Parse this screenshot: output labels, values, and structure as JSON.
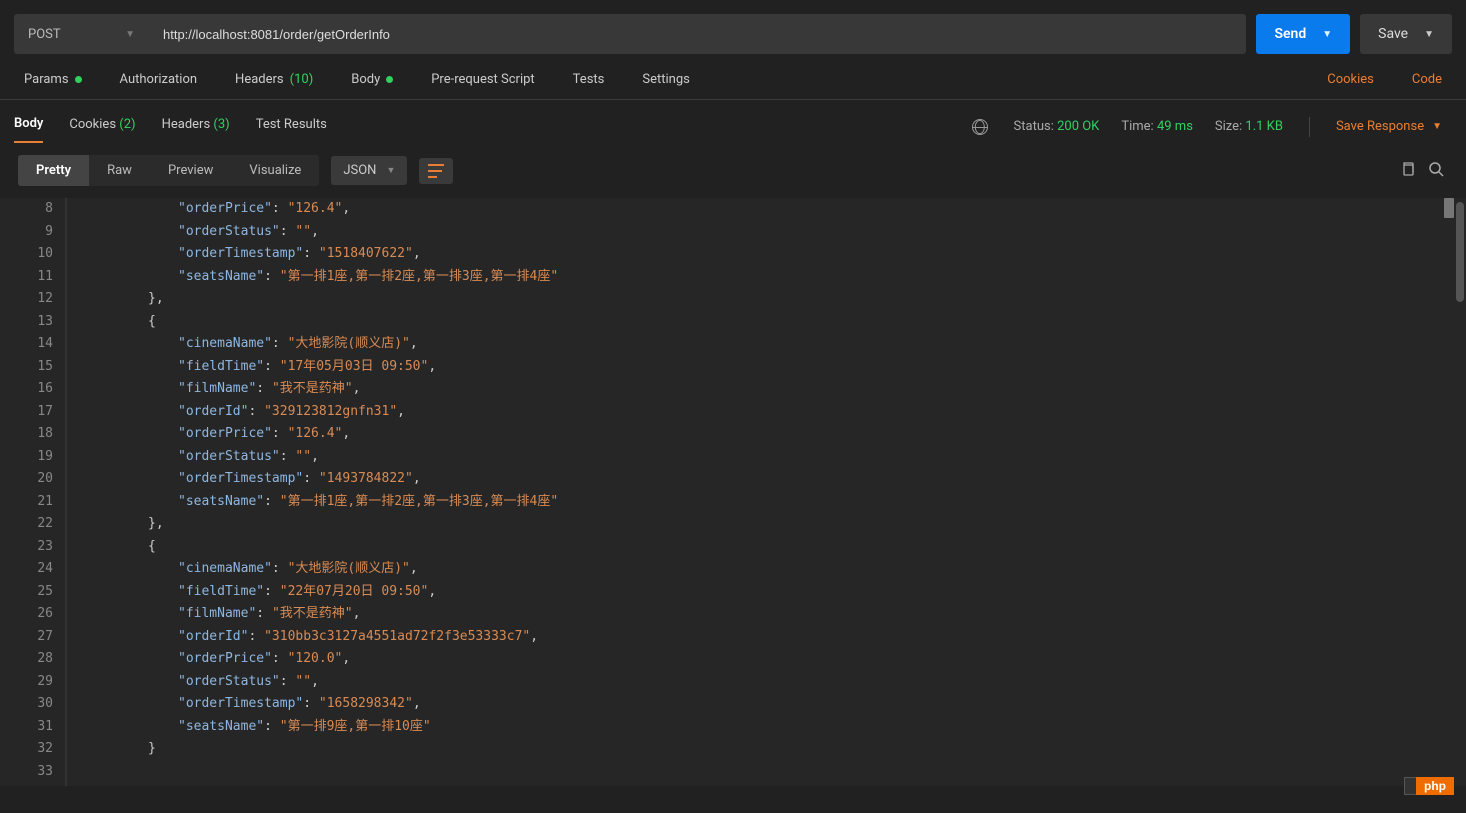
{
  "request": {
    "method": "POST",
    "url": "http://localhost:8081/order/getOrderInfo",
    "sendLabel": "Send",
    "saveLabel": "Save"
  },
  "reqTabs": {
    "params": "Params",
    "authorization": "Authorization",
    "headers": "Headers",
    "headersCount": "(10)",
    "body": "Body",
    "prerequest": "Pre-request Script",
    "tests": "Tests",
    "settings": "Settings",
    "cookies": "Cookies",
    "code": "Code"
  },
  "respTabs": {
    "body": "Body",
    "cookies": "Cookies",
    "cookiesCount": "(2)",
    "headers": "Headers",
    "headersCount": "(3)",
    "testResults": "Test Results"
  },
  "status": {
    "statusLabel": "Status:",
    "statusValue": "200 OK",
    "timeLabel": "Time:",
    "timeValue": "49 ms",
    "sizeLabel": "Size:",
    "sizeValue": "1.1 KB",
    "saveResponse": "Save Response"
  },
  "viewTabs": {
    "pretty": "Pretty",
    "raw": "Raw",
    "preview": "Preview",
    "visualize": "Visualize",
    "format": "JSON"
  },
  "code": {
    "startLine": 8,
    "lines": [
      [
        2,
        [
          [
            "key",
            "\"orderPrice\""
          ],
          [
            "colon",
            ": "
          ],
          [
            "str",
            "\"126.4\""
          ],
          [
            "punc",
            ","
          ]
        ]
      ],
      [
        2,
        [
          [
            "key",
            "\"orderStatus\""
          ],
          [
            "colon",
            ": "
          ],
          [
            "str",
            "\"\""
          ],
          [
            "punc",
            ","
          ]
        ]
      ],
      [
        2,
        [
          [
            "key",
            "\"orderTimestamp\""
          ],
          [
            "colon",
            ": "
          ],
          [
            "str",
            "\"1518407622\""
          ],
          [
            "punc",
            ","
          ]
        ]
      ],
      [
        2,
        [
          [
            "key",
            "\"seatsName\""
          ],
          [
            "colon",
            ": "
          ],
          [
            "str",
            "\"第一排1座,第一排2座,第一排3座,第一排4座\""
          ]
        ]
      ],
      [
        1,
        [
          [
            "punc",
            "},"
          ]
        ]
      ],
      [
        1,
        [
          [
            "punc",
            "{"
          ]
        ]
      ],
      [
        2,
        [
          [
            "key",
            "\"cinemaName\""
          ],
          [
            "colon",
            ": "
          ],
          [
            "str",
            "\"大地影院(顺义店)\""
          ],
          [
            "punc",
            ","
          ]
        ]
      ],
      [
        2,
        [
          [
            "key",
            "\"fieldTime\""
          ],
          [
            "colon",
            ": "
          ],
          [
            "str",
            "\"17年05月03日 09:50\""
          ],
          [
            "punc",
            ","
          ]
        ]
      ],
      [
        2,
        [
          [
            "key",
            "\"filmName\""
          ],
          [
            "colon",
            ": "
          ],
          [
            "str",
            "\"我不是药神\""
          ],
          [
            "punc",
            ","
          ]
        ]
      ],
      [
        2,
        [
          [
            "key",
            "\"orderId\""
          ],
          [
            "colon",
            ": "
          ],
          [
            "str",
            "\"329123812gnfn31\""
          ],
          [
            "punc",
            ","
          ]
        ]
      ],
      [
        2,
        [
          [
            "key",
            "\"orderPrice\""
          ],
          [
            "colon",
            ": "
          ],
          [
            "str",
            "\"126.4\""
          ],
          [
            "punc",
            ","
          ]
        ]
      ],
      [
        2,
        [
          [
            "key",
            "\"orderStatus\""
          ],
          [
            "colon",
            ": "
          ],
          [
            "str",
            "\"\""
          ],
          [
            "punc",
            ","
          ]
        ]
      ],
      [
        2,
        [
          [
            "key",
            "\"orderTimestamp\""
          ],
          [
            "colon",
            ": "
          ],
          [
            "str",
            "\"1493784822\""
          ],
          [
            "punc",
            ","
          ]
        ]
      ],
      [
        2,
        [
          [
            "key",
            "\"seatsName\""
          ],
          [
            "colon",
            ": "
          ],
          [
            "str",
            "\"第一排1座,第一排2座,第一排3座,第一排4座\""
          ]
        ]
      ],
      [
        1,
        [
          [
            "punc",
            "},"
          ]
        ]
      ],
      [
        1,
        [
          [
            "punc",
            "{"
          ]
        ]
      ],
      [
        2,
        [
          [
            "key",
            "\"cinemaName\""
          ],
          [
            "colon",
            ": "
          ],
          [
            "str",
            "\"大地影院(顺义店)\""
          ],
          [
            "punc",
            ","
          ]
        ]
      ],
      [
        2,
        [
          [
            "key",
            "\"fieldTime\""
          ],
          [
            "colon",
            ": "
          ],
          [
            "str",
            "\"22年07月20日 09:50\""
          ],
          [
            "punc",
            ","
          ]
        ]
      ],
      [
        2,
        [
          [
            "key",
            "\"filmName\""
          ],
          [
            "colon",
            ": "
          ],
          [
            "str",
            "\"我不是药神\""
          ],
          [
            "punc",
            ","
          ]
        ]
      ],
      [
        2,
        [
          [
            "key",
            "\"orderId\""
          ],
          [
            "colon",
            ": "
          ],
          [
            "str",
            "\"310bb3c3127a4551ad72f2f3e53333c7\""
          ],
          [
            "punc",
            ","
          ]
        ]
      ],
      [
        2,
        [
          [
            "key",
            "\"orderPrice\""
          ],
          [
            "colon",
            ": "
          ],
          [
            "str",
            "\"120.0\""
          ],
          [
            "punc",
            ","
          ]
        ]
      ],
      [
        2,
        [
          [
            "key",
            "\"orderStatus\""
          ],
          [
            "colon",
            ": "
          ],
          [
            "str",
            "\"\""
          ],
          [
            "punc",
            ","
          ]
        ]
      ],
      [
        2,
        [
          [
            "key",
            "\"orderTimestamp\""
          ],
          [
            "colon",
            ": "
          ],
          [
            "str",
            "\"1658298342\""
          ],
          [
            "punc",
            ","
          ]
        ]
      ],
      [
        2,
        [
          [
            "key",
            "\"seatsName\""
          ],
          [
            "colon",
            ": "
          ],
          [
            "str",
            "\"第一排9座,第一排10座\""
          ]
        ]
      ],
      [
        1,
        [
          [
            "punc",
            "}"
          ]
        ]
      ],
      [
        1,
        [
          [
            "punc",
            ""
          ]
        ]
      ]
    ]
  },
  "watermark": "php"
}
